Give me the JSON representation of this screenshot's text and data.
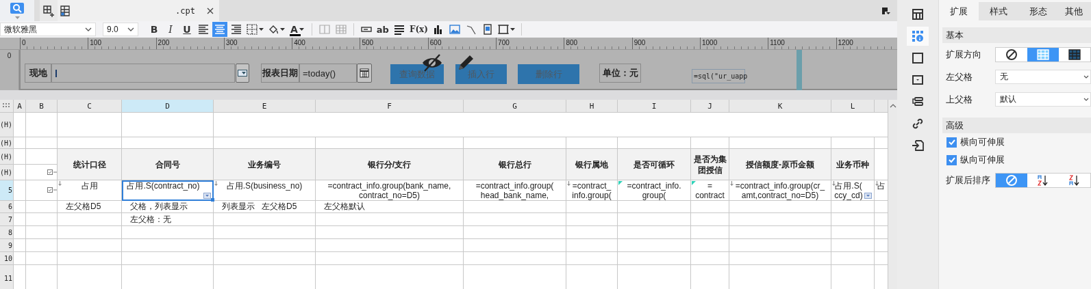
{
  "file_tab": {
    "title": ".cpt"
  },
  "toolbar": {
    "items": [
      {
        "kind": "select",
        "value": "微软雅黑"
      },
      {
        "kind": "select",
        "value": "9.0"
      },
      {
        "kind": "text",
        "label": "B"
      },
      {
        "kind": "text",
        "label": "I"
      },
      {
        "kind": "text",
        "label": "U"
      },
      {
        "kind": "icon",
        "selected": false
      },
      {
        "kind": "icon",
        "selected": true
      },
      {
        "kind": "icon",
        "selected": false
      },
      {
        "kind": "icon"
      },
      {
        "kind": "icon"
      },
      {
        "kind": "text",
        "label": "A"
      },
      {
        "kind": "sep"
      },
      {
        "kind": "icon",
        "disabled": true
      },
      {
        "kind": "icon",
        "disabled": true
      },
      {
        "kind": "sep"
      },
      {
        "kind": "icon"
      },
      {
        "kind": "text",
        "label": "ab"
      },
      {
        "kind": "icon"
      },
      {
        "kind": "text",
        "label": "F(x)"
      },
      {
        "kind": "icon"
      },
      {
        "kind": "icon"
      },
      {
        "kind": "icon"
      },
      {
        "kind": "icon"
      },
      {
        "kind": "icon"
      },
      {
        "kind": "sep"
      }
    ]
  },
  "ruler": {
    "marks": [
      "0",
      "100",
      "200",
      "300",
      "400",
      "500",
      "600",
      "700",
      "800",
      "900",
      "1000",
      "1100",
      "1200"
    ],
    "side_mark": "0"
  },
  "parameters": [
    {
      "kind": "label",
      "text": "现地"
    },
    {
      "kind": "field"
    },
    {
      "kind": "dropbutton"
    },
    {
      "kind": "label",
      "text": "报表日期"
    },
    {
      "kind": "field",
      "value": "=today()"
    },
    {
      "kind": "calendarbutton"
    },
    {
      "kind": "button",
      "text": "查询数据"
    },
    {
      "kind": "button",
      "text": "插入行"
    },
    {
      "kind": "button",
      "text": "删除行"
    },
    {
      "kind": "label",
      "text": "单位：元"
    },
    {
      "kind": "formula",
      "value": "=sql(\"ur_uapp"
    }
  ],
  "sheet": {
    "columns": [
      "A",
      "B",
      "C",
      "D",
      "E",
      "F",
      "G",
      "H",
      "I",
      "J",
      "K",
      "L"
    ],
    "rows": [
      {
        "label": "(H)",
        "cells": [
          {
            "kind": "empty"
          },
          {
            "kind": "empty"
          },
          {
            "kind": "empty"
          },
          {
            "kind": "empty"
          },
          {
            "kind": "empty"
          },
          {
            "kind": "joined"
          },
          {
            "kind": "joined"
          },
          {
            "kind": "joined"
          },
          {
            "kind": "joined"
          },
          {
            "kind": "joined"
          },
          {
            "kind": "joined"
          },
          {
            "kind": "joined"
          },
          {
            "kind": "joined"
          }
        ]
      },
      {
        "label": "(H)"
      },
      {
        "label": "(H)",
        "cells": [
          {
            "kind": "empty"
          },
          {
            "kind": "empty"
          },
          {
            "kind": "header",
            "text": "统计口径"
          },
          {
            "kind": "header",
            "text": "合同号"
          },
          {
            "kind": "header",
            "text": "业务编号"
          },
          {
            "kind": "header",
            "text": "银行分/支行"
          },
          {
            "kind": "header",
            "text": "银行总行"
          },
          {
            "kind": "header",
            "text": "银行属地"
          },
          {
            "kind": "header",
            "text": "是否可循环"
          },
          {
            "kind": "header",
            "text": "是否为集团授信"
          },
          {
            "kind": "header",
            "text": "授信额度-原币金额"
          },
          {
            "kind": "header",
            "text": "业务币种"
          },
          {
            "kind": "empty"
          }
        ]
      },
      {
        "label": "(H)",
        "cells": [
          {
            "kind": "empty"
          },
          {
            "kind": "marker"
          },
          {
            "kind": "below"
          },
          {
            "kind": "below"
          },
          {
            "kind": "below"
          },
          {
            "kind": "below"
          },
          {
            "kind": "below"
          },
          {
            "kind": "below"
          },
          {
            "kind": "below"
          },
          {
            "kind": "below"
          },
          {
            "kind": "below"
          },
          {
            "kind": "below"
          },
          {
            "kind": "below"
          }
        ]
      },
      {
        "label": "5",
        "cells": [
          {
            "kind": "empty"
          },
          {
            "kind": "marker"
          },
          {
            "kind": "value",
            "text": "占用",
            "expand_marker": true,
            "corner_marker": false,
            "dropdown": false,
            "selected": false
          },
          {
            "kind": "value",
            "text": "占用.S(contract_no)",
            "expand_marker": false,
            "corner_marker": false,
            "dropdown": true,
            "selected": true
          },
          {
            "kind": "value",
            "text": "占用.S(business_no)",
            "expand_marker": true,
            "corner_marker": false,
            "dropdown": false,
            "selected": false
          },
          {
            "kind": "value",
            "text": "=contract_info.group(bank_name,\ncontract_no=D5)",
            "expand_marker": false,
            "corner_marker": false,
            "dropdown": false,
            "selected": false
          },
          {
            "kind": "value",
            "text": "=contract_info.group(\nhead_bank_name,",
            "expand_marker": false,
            "corner_marker": false,
            "dropdown": false,
            "selected": false
          },
          {
            "kind": "value",
            "text": "=contract_\ninfo.group(",
            "expand_marker": true,
            "corner_marker": false,
            "dropdown": false,
            "selected": false
          },
          {
            "kind": "value",
            "text": "=contract_info.\ngroup(",
            "expand_marker": false,
            "corner_marker": true,
            "dropdown": false,
            "selected": false
          },
          {
            "kind": "value",
            "text": "=\ncontract",
            "expand_marker": false,
            "corner_marker": true,
            "dropdown": false,
            "selected": false
          },
          {
            "kind": "value",
            "text": "=contract_info.group(cr_\namt,contract_no=D5)",
            "expand_marker": true,
            "corner_marker": false,
            "dropdown": false,
            "selected": false
          },
          {
            "kind": "value",
            "text": "占用.S(\nccy_cd)",
            "expand_marker": true,
            "corner_marker": false,
            "dropdown": true,
            "selected": false
          },
          {
            "kind": "value",
            "text": "占",
            "expand_marker": true,
            "corner_marker": false,
            "dropdown": false,
            "selected": false
          }
        ]
      },
      {
        "label": "6",
        "cells": [
          {
            "kind": "empty"
          },
          {
            "kind": "empty"
          },
          {
            "kind": "note",
            "text": "左父格D5"
          },
          {
            "kind": "note",
            "text": "父格，列表显示"
          },
          {
            "kind": "note",
            "text": "列表显示   左父格D5"
          },
          {
            "kind": "note",
            "text": "左父格默认"
          }
        ]
      },
      {
        "label": "7",
        "cells": [
          {
            "kind": "empty"
          },
          {
            "kind": "empty"
          },
          {
            "kind": "empty"
          },
          {
            "kind": "note",
            "text": "左父格：无"
          }
        ]
      },
      {
        "label": "8"
      },
      {
        "label": "9"
      },
      {
        "label": "10"
      },
      {
        "label": "11"
      }
    ]
  },
  "side_icons": [
    {
      "selected": false
    },
    {
      "selected": true
    },
    {
      "selected": false
    },
    {
      "selected": false
    },
    {
      "selected": false
    },
    {
      "selected": false
    },
    {
      "selected": false
    }
  ],
  "properties": {
    "tabs": [
      {
        "label": "扩展",
        "selected": true
      },
      {
        "label": "样式",
        "selected": false
      },
      {
        "label": "形态",
        "selected": false
      },
      {
        "label": "其他",
        "selected": false
      }
    ],
    "sections": [
      {
        "title": "基本",
        "items": [
          {
            "kind": "segments",
            "label": "扩展方向",
            "options": [
              {
                "selected": false
              },
              {
                "selected": true
              },
              {
                "selected": false
              }
            ]
          },
          {
            "kind": "select",
            "label": "左父格",
            "value": "无"
          },
          {
            "kind": "select",
            "label": "上父格",
            "value": "默认"
          }
        ]
      },
      {
        "title": "高级",
        "items": [
          {
            "kind": "checkbox",
            "label": "横向可伸展",
            "checked": true
          },
          {
            "kind": "checkbox",
            "label": "纵向可伸展",
            "checked": true
          },
          {
            "kind": "segments",
            "label": "扩展后排序",
            "options": [
              {
                "selected": true
              },
              {
                "selected": false
              },
              {
                "selected": false
              }
            ]
          }
        ]
      }
    ]
  }
}
